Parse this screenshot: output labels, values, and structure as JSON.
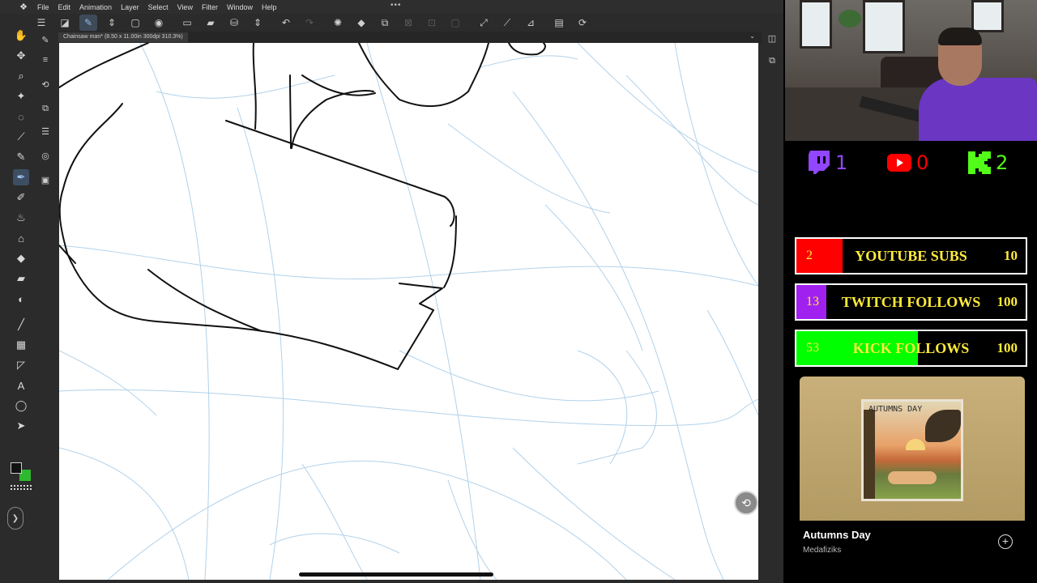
{
  "menubar": {
    "items": [
      "File",
      "Edit",
      "Animation",
      "Layer",
      "Select",
      "View",
      "Filter",
      "Window",
      "Help"
    ],
    "more": "•••"
  },
  "document": {
    "tab_title": "Chainsaw man* (8.50 x 11.00in 300dpi 310.3%)"
  },
  "tools": {
    "selected": "pen-tool",
    "colors": {
      "main": "#111111",
      "sub": "#2fb82f"
    }
  },
  "canvas": {
    "background": "#ffffff",
    "ink_color": "#111111",
    "sketch_color": "#a9cde8"
  },
  "stream": {
    "counts": [
      {
        "platform": "twitch-icon",
        "value": "1",
        "color": "#9146ff"
      },
      {
        "platform": "youtube-icon",
        "value": "0",
        "color": "#ff0000"
      },
      {
        "platform": "kick-icon",
        "value": "2",
        "color": "#53fc18"
      }
    ],
    "goals": [
      {
        "current": "2",
        "title": "YOUTUBE SUBS",
        "target": "10",
        "fill_color": "#ff0000",
        "progress": 0.2
      },
      {
        "current": "13",
        "title": "TWITCH FOLLOWS",
        "target": "100",
        "fill_color": "#a020f0",
        "progress": 0.13
      },
      {
        "current": "53",
        "title": "KICK FOLLOWS",
        "target": "100",
        "fill_color": "#00ff00",
        "progress": 0.53
      }
    ],
    "music": {
      "cover_text": "AUTUMNS DAY",
      "song": "Autumns Day",
      "artist": "Medafiziks"
    }
  }
}
